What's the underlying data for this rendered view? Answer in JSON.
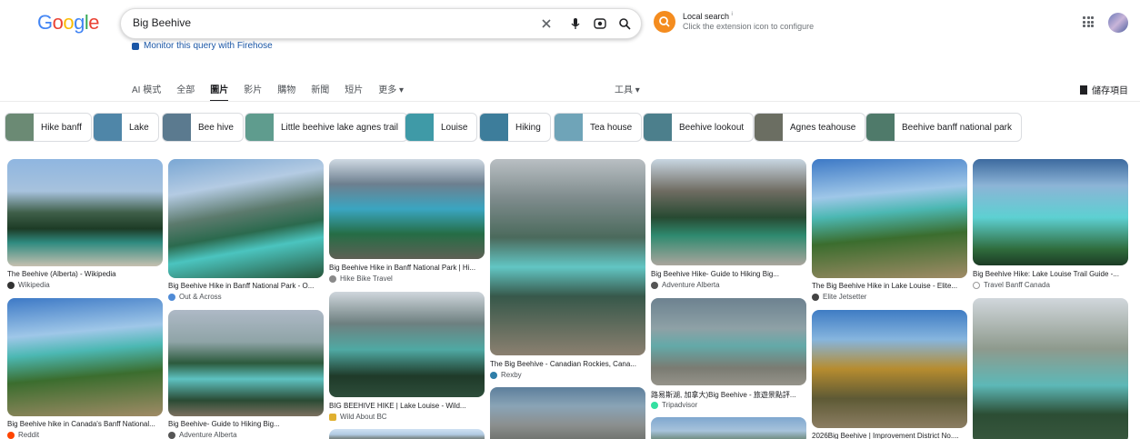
{
  "search": {
    "query": "Big Beehive",
    "firehose_link": "Monitor this query with Firehose"
  },
  "local_search": {
    "title": "Local search",
    "info_mark": "i",
    "subtitle": "Click the extension icon to configure"
  },
  "tabs": [
    {
      "label": "AI 模式",
      "active": false
    },
    {
      "label": "全部",
      "active": false
    },
    {
      "label": "圖片",
      "active": true
    },
    {
      "label": "影片",
      "active": false
    },
    {
      "label": "購物",
      "active": false
    },
    {
      "label": "新聞",
      "active": false
    },
    {
      "label": "短片",
      "active": false
    },
    {
      "label": "更多 ▾",
      "active": false
    }
  ],
  "tools_label": "工具 ▾",
  "saved_label": "儲存項目",
  "chips": [
    {
      "label": "Hike banff",
      "color": "#6b8a74"
    },
    {
      "label": "Lake",
      "color": "#4f86a8"
    },
    {
      "label": "Bee hive",
      "color": "#5b7a8f"
    },
    {
      "label": "Little beehive lake agnes trail",
      "color": "#5f9c8e"
    },
    {
      "label": "Louise",
      "color": "#3f9aa7"
    },
    {
      "label": "Hiking",
      "color": "#3d7d9b"
    },
    {
      "label": "Tea house",
      "color": "#6fa4b8"
    },
    {
      "label": "Beehive lookout",
      "color": "#4c7f8c"
    },
    {
      "label": "Agnes teahouse",
      "color": "#6b6e62"
    },
    {
      "label": "Beehive banff national park",
      "color": "#4f7a6a"
    }
  ],
  "results": [
    {
      "caption": "The Beehive (Alberta) - Wikipedia",
      "source": "Wikipedia",
      "fav": "#333333"
    },
    {
      "caption": "Big Beehive Hike in Banff National Park - O...",
      "source": "Out & Across",
      "fav": "#4f8bd6"
    },
    {
      "caption": "Big Beehive Hike in Banff National Park | Hi...",
      "source": "Hike Bike Travel",
      "fav": "#8a8a8a"
    },
    {
      "caption": "The Big Beehive - Canadian Rockies, Cana...",
      "source": "Rexby",
      "fav": "#2f7ea8"
    },
    {
      "caption": "Big Beehive Hike- Guide to Hiking Big...",
      "source": "Adventure Alberta",
      "fav": "#555555"
    },
    {
      "caption": "The Big Beehive Hike in Lake Louise - Elite...",
      "source": "Elite Jetsetter",
      "fav": "#444444"
    },
    {
      "caption": "Big Beehive Hike: Lake Louise Trail Guide -...",
      "source": "Travel Banff Canada",
      "fav": "#9a9a9a"
    },
    {
      "caption": "Big Beehive hike in Canada's Banff National...",
      "source": "Reddit",
      "fav": "#ff4500"
    },
    {
      "caption": "Big Beehive- Guide to Hiking Big...",
      "source": "Adventure Alberta",
      "fav": "#555555"
    },
    {
      "caption": "BIG BEEHIVE HIKE | Lake Louise - Wild...",
      "source": "Wild About BC",
      "fav": "#e0b030"
    },
    {
      "caption": "路易斯湖, 加拿大)Big Beehive - 旅遊景點評...",
      "source": "Tripadvisor",
      "fav": "#34e0a1"
    },
    {
      "caption": "2026Big Beehive | Improvement District No....",
      "source": "",
      "fav": "#ffffff"
    }
  ]
}
